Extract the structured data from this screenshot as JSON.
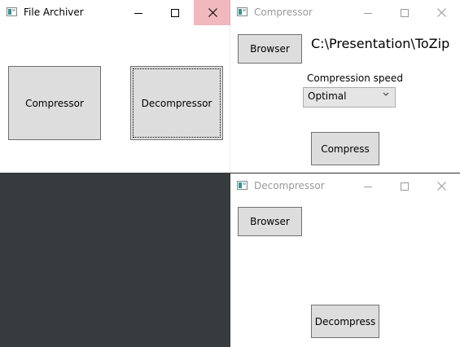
{
  "archiver": {
    "title": "File Archiver",
    "compressor_button": "Compressor",
    "decompressor_button": "Decompressor"
  },
  "compressor": {
    "title": "Compressor",
    "browser_button": "Browser",
    "path": "C:\\Presentation\\ToZip",
    "speed_label": "Compression speed",
    "speed_value": "Optimal",
    "compress_button": "Compress"
  },
  "decompressor": {
    "title": "Decompressor",
    "browser_button": "Browser",
    "decompress_button": "Decompress"
  },
  "icons": {
    "app": "app-icon",
    "minimize": "minimize-icon",
    "maximize": "maximize-icon",
    "close": "close-icon",
    "dropdown": "chevron-down-icon"
  },
  "colors": {
    "desktop": "#383b3e",
    "button_face": "#dddddd",
    "close_hover": "#f1b8bd"
  }
}
